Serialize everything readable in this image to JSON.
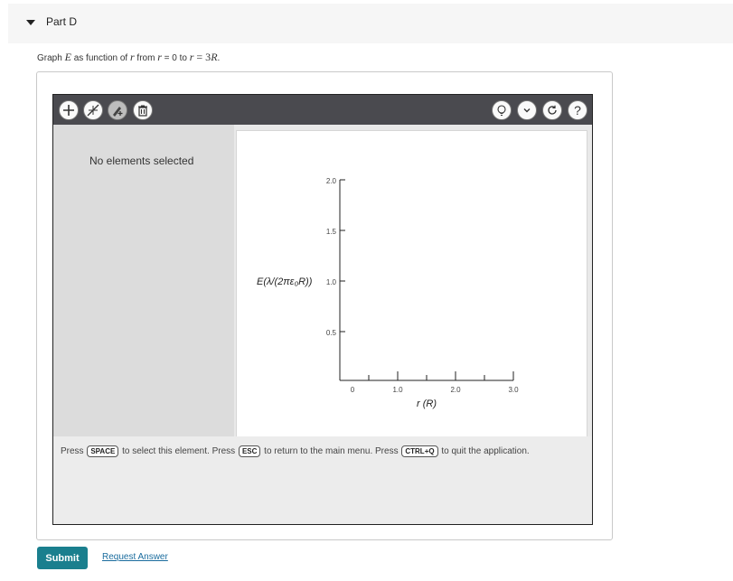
{
  "part": {
    "title": "Part D"
  },
  "instruction": {
    "prefix": "Graph ",
    "E": "E",
    "mid": " as function of ",
    "r1": "r",
    "from": " from ",
    "r2": "r",
    "eq0": " = 0 to ",
    "r3": "r",
    "eq3": " = 3",
    "R": "R",
    "end": "."
  },
  "toolbar": {
    "left_icons": [
      "add-icon",
      "line-tool-icon",
      "point-tool-icon",
      "trash-icon"
    ],
    "right_icons": [
      "hint-lightbulb-icon",
      "dropdown-icon",
      "reset-icon",
      "help-icon"
    ]
  },
  "left_panel": {
    "no_selection": "No elements selected"
  },
  "graph": {
    "ylabel": "E(λ/(2πε₀R))",
    "xlabel": "r (R)",
    "y_ticks": [
      "2.0",
      "1.5",
      "1.0",
      "0.5"
    ],
    "x_ticks": [
      "0",
      "1.0",
      "2.0",
      "3.0"
    ]
  },
  "help": {
    "p1": "Press ",
    "k1": "SPACE",
    "p2": " to select this element. Press ",
    "k2": "ESC",
    "p3": " to return to the main menu. Press ",
    "k3": "CTRL+Q",
    "p4": " to quit the application."
  },
  "actions": {
    "submit": "Submit",
    "request": "Request Answer"
  },
  "colors": {
    "toolbar": "#4a4a4f",
    "submit": "#1a7f8e",
    "link": "#1a6c9e"
  }
}
